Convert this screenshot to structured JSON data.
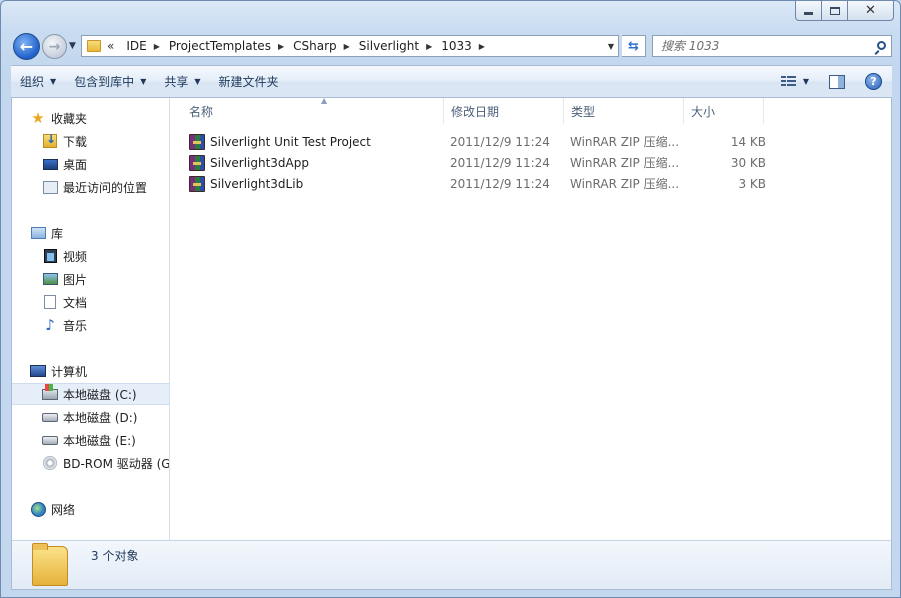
{
  "window": {
    "min_label": "",
    "max_label": "",
    "close_label": "✕"
  },
  "address": {
    "overflow": "«",
    "crumbs": [
      {
        "label": "IDE"
      },
      {
        "label": "ProjectTemplates"
      },
      {
        "label": "CSharp"
      },
      {
        "label": "Silverlight"
      },
      {
        "label": "1033"
      }
    ]
  },
  "search": {
    "placeholder": "搜索 1033"
  },
  "toolbar": {
    "organize": "组织",
    "include_library": "包含到库中",
    "share": "共享",
    "new_folder": "新建文件夹"
  },
  "nav": {
    "favorites": "收藏夹",
    "downloads": "下载",
    "desktop": "桌面",
    "recent": "最近访问的位置",
    "libraries": "库",
    "videos": "视频",
    "pictures": "图片",
    "documents": "文档",
    "music": "音乐",
    "computer": "计算机",
    "drive_c": "本地磁盘 (C:)",
    "drive_d": "本地磁盘 (D:)",
    "drive_e": "本地磁盘 (E:)",
    "drive_bd": "BD-ROM 驱动器 (G",
    "network": "网络"
  },
  "columns": {
    "name": "名称",
    "modified": "修改日期",
    "type": "类型",
    "size": "大小"
  },
  "files": [
    {
      "name": "Silverlight Unit Test Project",
      "modified": "2011/12/9 11:24",
      "type": "WinRAR ZIP 压缩...",
      "size": "14 KB"
    },
    {
      "name": "Silverlight3dApp",
      "modified": "2011/12/9 11:24",
      "type": "WinRAR ZIP 压缩...",
      "size": "30 KB"
    },
    {
      "name": "Silverlight3dLib",
      "modified": "2011/12/9 11:24",
      "type": "WinRAR ZIP 压缩...",
      "size": "3 KB"
    }
  ],
  "details": {
    "count": "3 个对象"
  }
}
